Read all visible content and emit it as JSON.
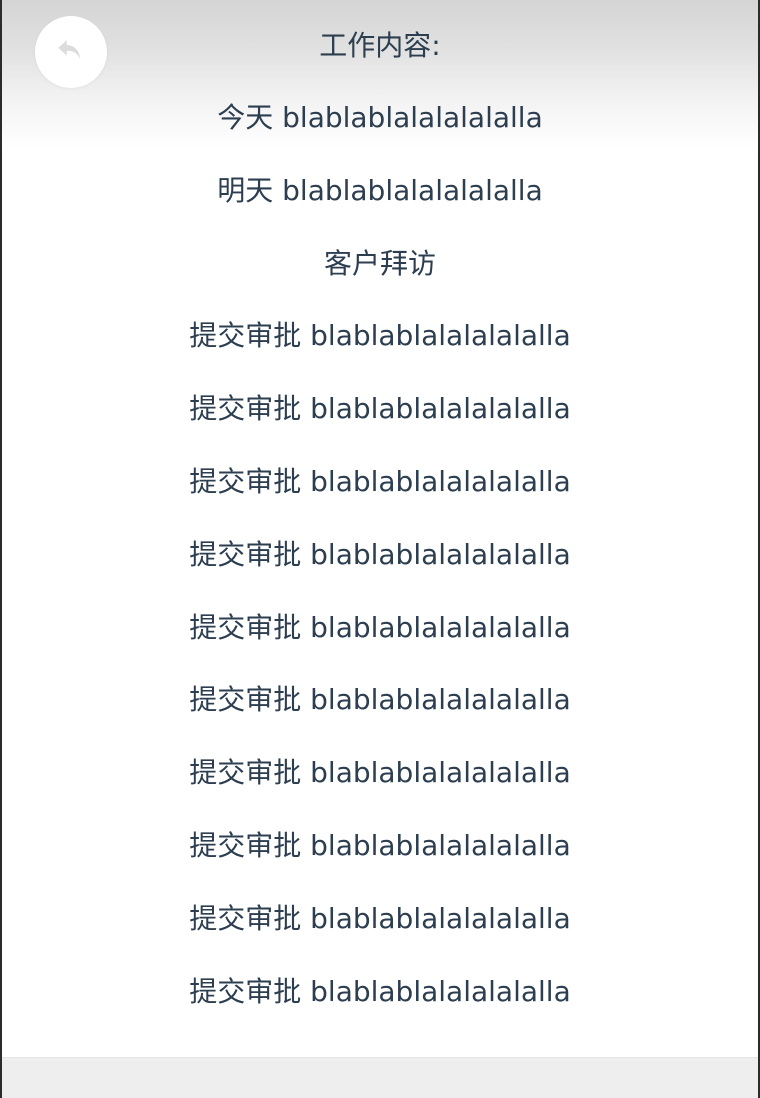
{
  "header": {
    "back_icon": "undo-arrow-icon"
  },
  "content": {
    "title": "工作内容:",
    "lines": [
      "今天 blablablalalalalalla",
      "明天 blablablalalalalalla",
      "客户拜访",
      "提交审批 blablablalalalalalla",
      "提交审批 blablablalalalalalla",
      "提交审批 blablablalalalalalla",
      "提交审批 blablablalalalalalla",
      "提交审批 blablablalalalalalla",
      "提交审批 blablablalalalalalla",
      "提交审批 blablablalalalalalla",
      "提交审批 blablablalalalalalla",
      "提交审批 blablablalalalalalla",
      "提交审批 blablablalalalalalla"
    ]
  },
  "colors": {
    "text": "#2c3e50",
    "icon": "#dcdcdc",
    "bottom_bar": "#eeeeee"
  }
}
